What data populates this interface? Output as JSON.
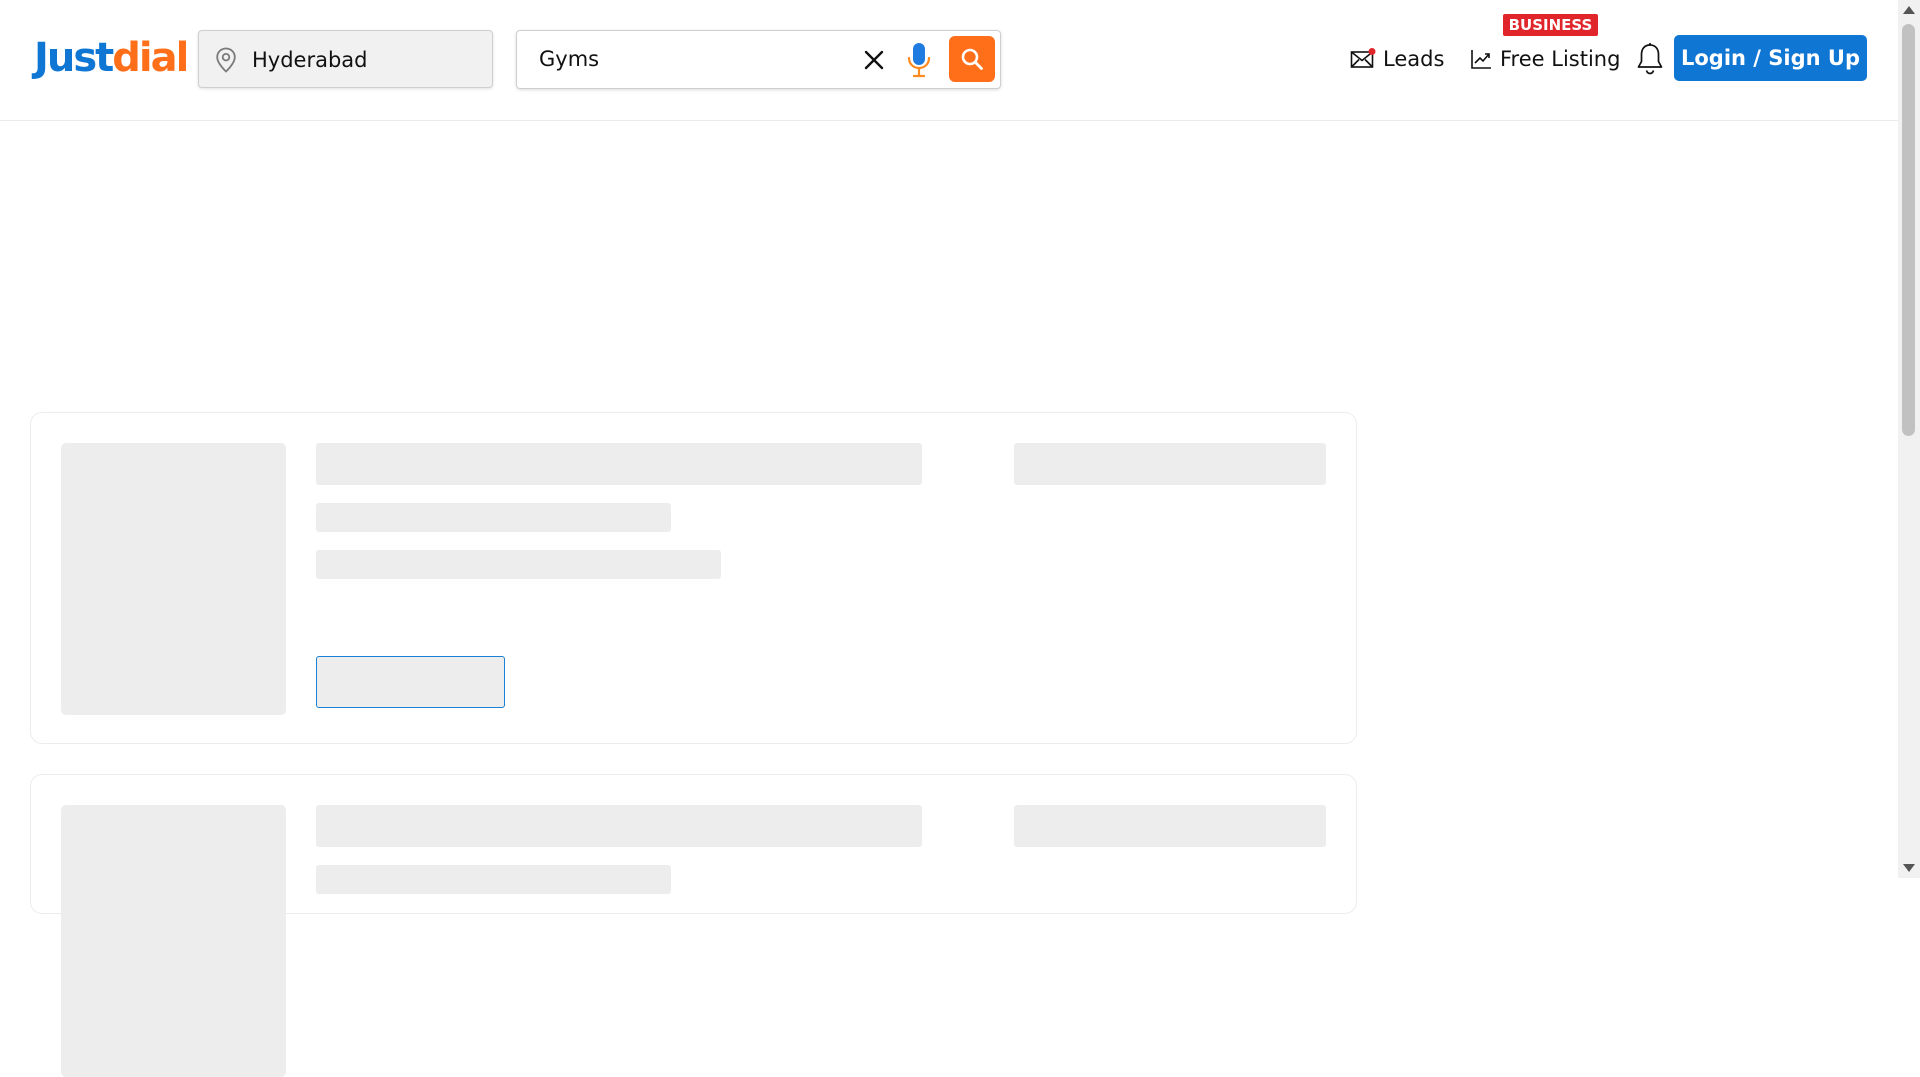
{
  "brand": {
    "name_part1": "Just",
    "name_part2": "dial"
  },
  "location": {
    "value": "Hyderabad",
    "icon": "location-pin-icon"
  },
  "search": {
    "value": "Gyms"
  },
  "nav": {
    "leads_label": "Leads",
    "free_listing_label": "Free Listing",
    "business_badge": "BUSINESS",
    "login_label": "Login / Sign Up"
  },
  "colors": {
    "brand_blue": "#0f76d3",
    "brand_orange": "#ff6f1a",
    "badge_red": "#e0262b",
    "skeleton": "#ededed"
  }
}
